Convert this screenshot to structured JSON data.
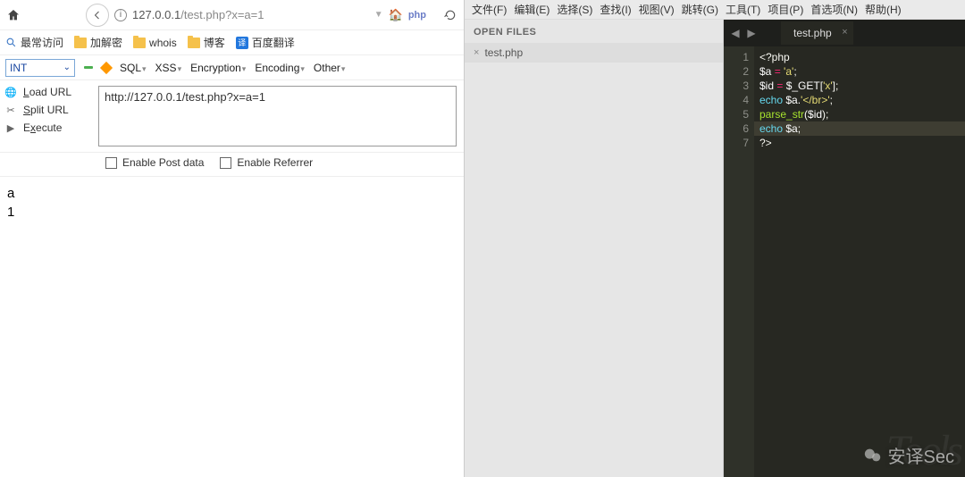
{
  "browser": {
    "url_host": "127.0.0.1",
    "url_path": "/test.php?x=a=1",
    "php_tag": "php",
    "bookmarks": {
      "most_visited": "最常访问",
      "encrypt": "加解密",
      "whois": "whois",
      "blog": "博客",
      "baidu_translate": "百度翻译"
    }
  },
  "hackbar": {
    "mode": "INT",
    "menus": {
      "sql": "SQL",
      "xss": "XSS",
      "encryption": "Encryption",
      "encoding": "Encoding",
      "other": "Other"
    },
    "left": {
      "load": "Load URL",
      "load_ul": "L",
      "split": "Split URL",
      "split_ul": "S",
      "exec": "Execute",
      "exec_ul": "x"
    },
    "input_url": "http://127.0.0.1/test.php?x=a=1",
    "opts": {
      "post": "Enable Post data",
      "ref": "Enable Referrer"
    }
  },
  "page_output": {
    "line1": "a",
    "line2": "1"
  },
  "editor": {
    "menus": [
      "文件(F)",
      "编辑(E)",
      "选择(S)",
      "查找(I)",
      "视图(V)",
      "跳转(G)",
      "工具(T)",
      "项目(P)",
      "首选项(N)",
      "帮助(H)"
    ],
    "open_files_label": "OPEN FILES",
    "open_file": "test.php",
    "tab_name": "test.php",
    "code": {
      "l1": "<?php",
      "l2a": "$a",
      "l2b": " = ",
      "l2c": "'a'",
      "l2d": ";",
      "l3a": "$id",
      "l3b": " = ",
      "l3c": "$_GET",
      "l3d": "[",
      "l3e": "'x'",
      "l3f": "];",
      "l4a": "echo",
      "l4b": " $a.",
      "l4c": "'</br>'",
      "l4d": ";",
      "l5a": "parse_str",
      "l5b": "(",
      "l5c": "$id",
      "l5d": ");",
      "l6a": "echo",
      "l6b": " $a",
      "l6c": ";",
      "l7": "?>"
    },
    "line_numbers": [
      "1",
      "2",
      "3",
      "4",
      "5",
      "6",
      "7"
    ]
  },
  "watermark": {
    "text": "安译Sec",
    "bg": "Tools"
  }
}
